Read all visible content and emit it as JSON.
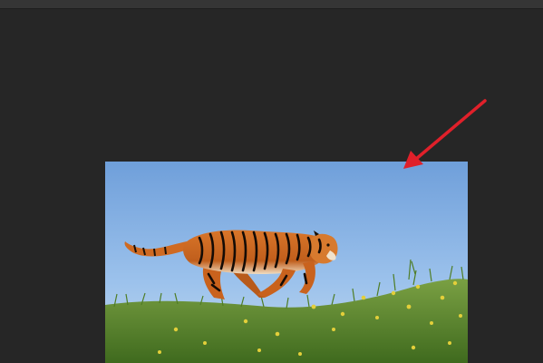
{
  "app": {
    "theme": "dark",
    "workspace_color": "#262626",
    "toolbar_color": "#353535"
  },
  "canvas": {
    "content": "photo-tiger-running-on-grass",
    "sky_color": "#8fb8e6",
    "grass_color": "#5d8a2f"
  },
  "annotation": {
    "type": "arrow",
    "color": "#e0202a",
    "direction": "pointing-down-left"
  }
}
